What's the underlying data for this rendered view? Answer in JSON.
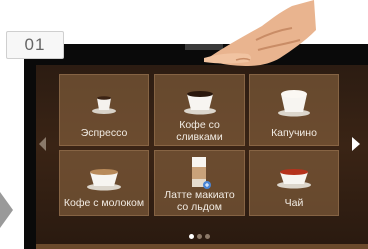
{
  "step_badge": "01",
  "tiles": [
    {
      "label": "Эспрессо",
      "icon": "espresso-cup-icon"
    },
    {
      "label": "Кофе со\nсливками",
      "icon": "coffee-cream-cup-icon"
    },
    {
      "label": "Капучино",
      "icon": "cappuccino-cup-icon"
    },
    {
      "label": "Кофе с молоком",
      "icon": "coffee-milk-cup-icon"
    },
    {
      "label": "Латте макиато\nсо льдом",
      "icon": "iced-latte-glass-icon"
    },
    {
      "label": "Чай",
      "icon": "tea-cup-icon"
    }
  ],
  "pagination": {
    "pages": 3,
    "active": 1
  },
  "colors": {
    "screen_bg": "#3a2415",
    "tile_bg": "#8a6a48",
    "text": "#f2ece4"
  }
}
